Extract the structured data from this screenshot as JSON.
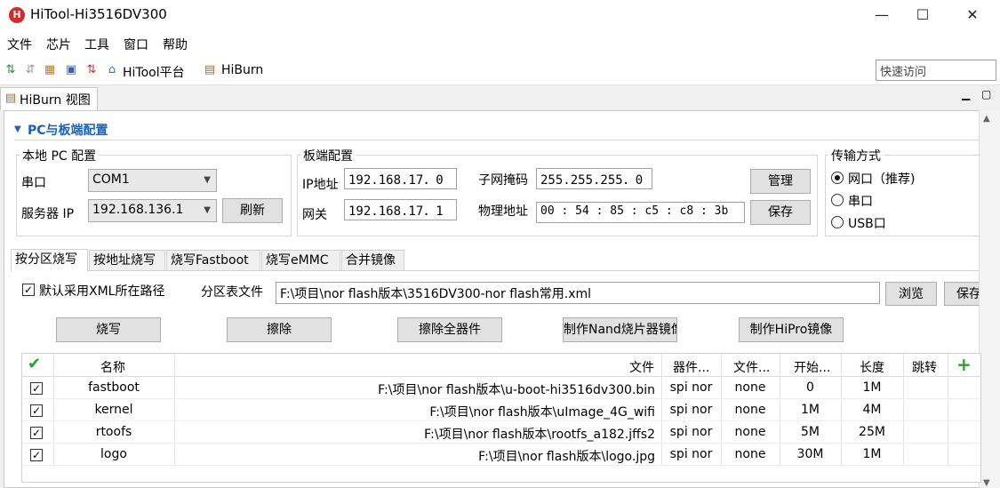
{
  "window": {
    "title": "HiTool-Hi3516DV300",
    "icon_text": "H"
  },
  "menu": {
    "items": [
      "文件",
      "芯片",
      "工具",
      "窗口",
      "帮助"
    ]
  },
  "toolbar": {
    "platform_label": "HiTool平台",
    "hiburn_label": "HiBurn",
    "quick_access_placeholder": "快速访问"
  },
  "view_tab": {
    "label": "HiBurn 视图"
  },
  "section": {
    "title": "PC与板端配置"
  },
  "local_pc": {
    "title": "本地 PC 配置",
    "serial_label": "串口",
    "serial_value": "COM1",
    "server_ip_label": "服务器 IP",
    "server_ip_value": "192.168.136.1",
    "refresh_label": "刷新"
  },
  "board": {
    "title": "板端配置",
    "ip_label": "IP地址",
    "ip_value": "192.168.17．0",
    "mask_label": "子网掩码",
    "mask_value": "255.255.255．0",
    "gateway_label": "网关",
    "gateway_value": "192.168.17．1",
    "mac_label": "物理地址",
    "mac_value": "00 : 54 : 85 : c5 : c8 : 3b",
    "manage_label": "管理",
    "save_label": "保存"
  },
  "transfer": {
    "title": "传输方式",
    "options": [
      "网口（推荐)",
      "串口",
      "USB口"
    ],
    "selected": "网口（推荐)"
  },
  "burn_tabs": [
    "按分区烧写",
    "按地址烧写",
    "烧写Fastboot",
    "烧写eMMC",
    "合并镜像"
  ],
  "partition": {
    "use_xml_label": "默认采用XML所在路径",
    "use_xml_checked": true,
    "table_file_label": "分区表文件",
    "table_file_value": "F:\\项目\\nor flash版本\\3516DV300-nor flash常用.xml",
    "browse_label": "浏览",
    "save_label": "保存"
  },
  "actions": [
    "烧写",
    "擦除",
    "擦除全器件",
    "制作Nand烧片器镜像",
    "制作HiPro镜像"
  ],
  "table": {
    "headers": [
      "名称",
      "文件",
      "器件...",
      "文件...",
      "开始...",
      "长度",
      "跳转"
    ],
    "rows": [
      {
        "checked": true,
        "name": "fastboot",
        "file": "F:\\项目\\nor flash版本\\u-boot-hi3516dv300.bin",
        "device": "spi nor",
        "ftype": "none",
        "start": "0",
        "length": "1M",
        "jump": ""
      },
      {
        "checked": true,
        "name": "kernel",
        "file": "F:\\项目\\nor flash版本\\uImage_4G_wifi",
        "device": "spi nor",
        "ftype": "none",
        "start": "1M",
        "length": "4M",
        "jump": ""
      },
      {
        "checked": true,
        "name": "rtoofs",
        "file": "F:\\项目\\nor flash版本\\rootfs_a182.jffs2",
        "device": "spi nor",
        "ftype": "none",
        "start": "5M",
        "length": "25M",
        "jump": ""
      },
      {
        "checked": true,
        "name": "logo",
        "file": "F:\\项目\\nor flash版本\\logo.jpg",
        "device": "spi nor",
        "ftype": "none",
        "start": "30M",
        "length": "1M",
        "jump": ""
      }
    ]
  },
  "colors": {
    "accent": "#1a62b4",
    "check_green": "#2e9e2e",
    "add_green": "#27a327"
  }
}
